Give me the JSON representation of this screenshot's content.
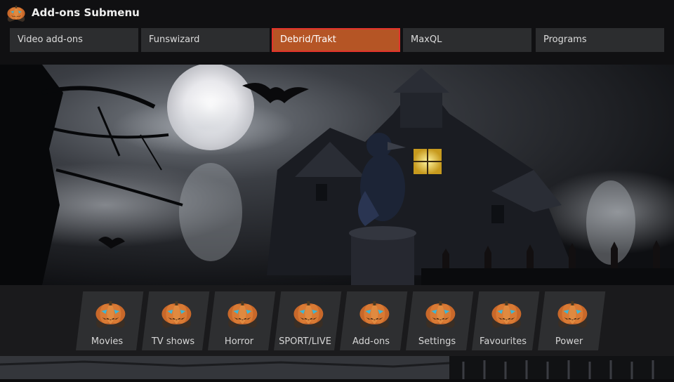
{
  "header": {
    "title": "Add-ons Submenu",
    "logo_icon": "pumpkin-icon"
  },
  "submenu": {
    "items": [
      {
        "label": "Video add-ons",
        "active": false
      },
      {
        "label": "Funswizard",
        "active": false
      },
      {
        "label": "Debrid/Trakt",
        "active": true
      },
      {
        "label": "MaxQL",
        "active": false
      },
      {
        "label": "Programs",
        "active": false
      }
    ]
  },
  "main_menu": {
    "items": [
      {
        "label": "Movies",
        "icon": "pumpkin-icon"
      },
      {
        "label": "TV shows",
        "icon": "pumpkin-icon"
      },
      {
        "label": "Horror",
        "icon": "pumpkin-icon"
      },
      {
        "label": "SPORT/LIVE",
        "icon": "pumpkin-icon"
      },
      {
        "label": "Add-ons",
        "icon": "pumpkin-icon"
      },
      {
        "label": "Settings",
        "icon": "pumpkin-icon"
      },
      {
        "label": "Favourites",
        "icon": "pumpkin-icon"
      },
      {
        "label": "Power",
        "icon": "pumpkin-icon"
      }
    ]
  },
  "colors": {
    "active_item_bg": "#b55525",
    "active_item_border": "#e3342b",
    "item_bg": "#2c2d2f",
    "pumpkin": "#c8682a",
    "pumpkin_eyes": "#3fb6d4"
  }
}
